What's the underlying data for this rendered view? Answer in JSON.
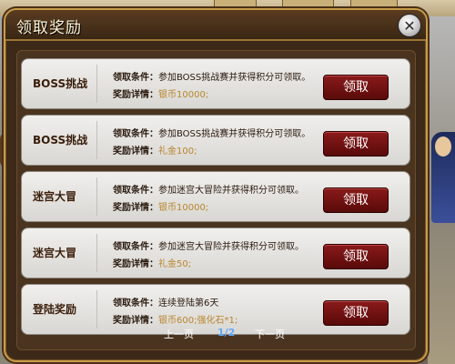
{
  "dialog": {
    "title": "领取奖励"
  },
  "labels": {
    "condition": "领取条件：",
    "reward": "奖励详情："
  },
  "rewards": [
    {
      "name": "BOSS挑战",
      "condition": "参加BOSS挑战赛并获得积分可领取。",
      "reward": "银币10000;",
      "button": "领取"
    },
    {
      "name": "BOSS挑战",
      "condition": "参加BOSS挑战赛并获得积分可领取。",
      "reward": "礼金100;",
      "button": "领取"
    },
    {
      "name": "迷宫大冒",
      "condition": "参加迷宫大冒险并获得积分可领取。",
      "reward": "银币10000;",
      "button": "领取"
    },
    {
      "name": "迷宫大冒",
      "condition": "参加迷宫大冒险并获得积分可领取。",
      "reward": "礼金50;",
      "button": "领取"
    },
    {
      "name": "登陆奖励",
      "condition": "连续登陆第6天",
      "reward": "银币600;强化石*1;",
      "button": "领取"
    }
  ],
  "pager": {
    "prev": "上一页",
    "page": "1/2",
    "next": "下一页"
  },
  "icons": {
    "close": "close-icon"
  },
  "colors": {
    "claim_button": "#6e1111",
    "reward_text": "#b8862b",
    "frame": "#c79c4a"
  }
}
